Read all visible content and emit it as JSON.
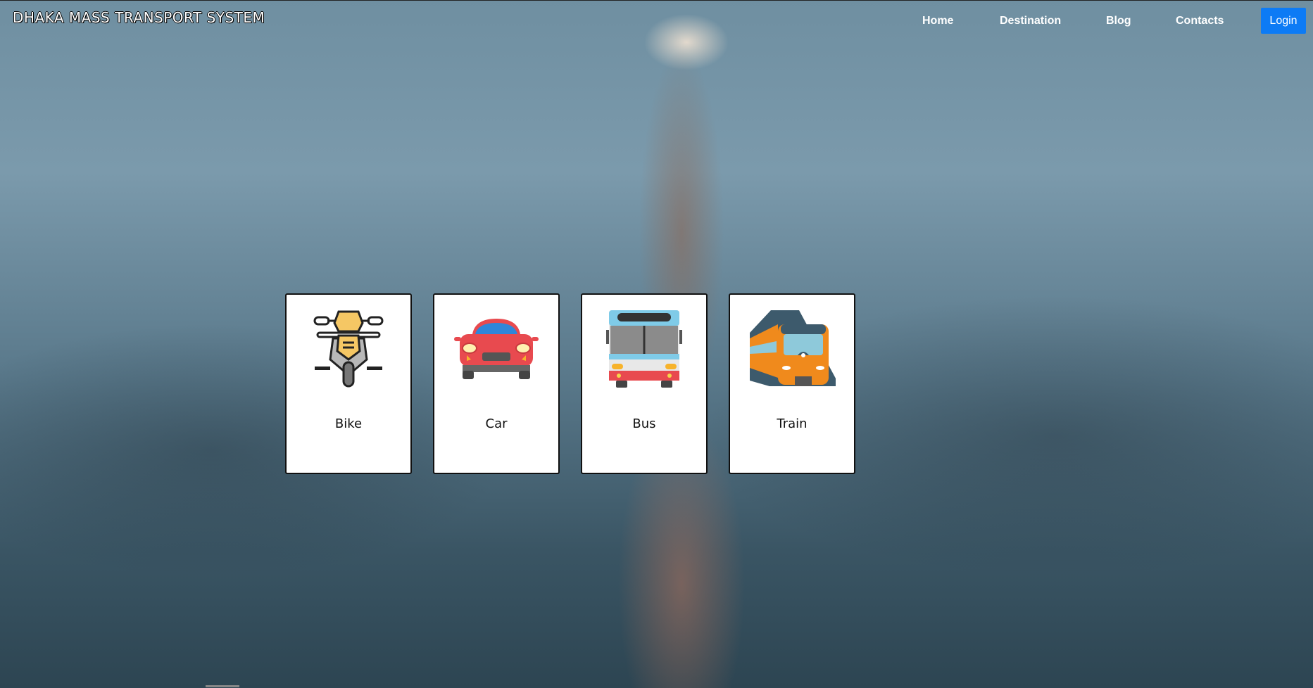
{
  "brand": "DHAKA MASS TRANSPORT SYSTEM",
  "nav": {
    "home": "Home",
    "destination": "Destination",
    "blog": "Blog",
    "contacts": "Contacts",
    "login": "Login"
  },
  "transport_options": [
    {
      "label": "Bike",
      "icon": "motorcycle-icon"
    },
    {
      "label": "Car",
      "icon": "car-icon"
    },
    {
      "label": "Bus",
      "icon": "bus-icon"
    },
    {
      "label": "Train",
      "icon": "train-icon"
    }
  ],
  "colors": {
    "login_button": "#0d7bf5",
    "card_background": "#ffffff"
  }
}
